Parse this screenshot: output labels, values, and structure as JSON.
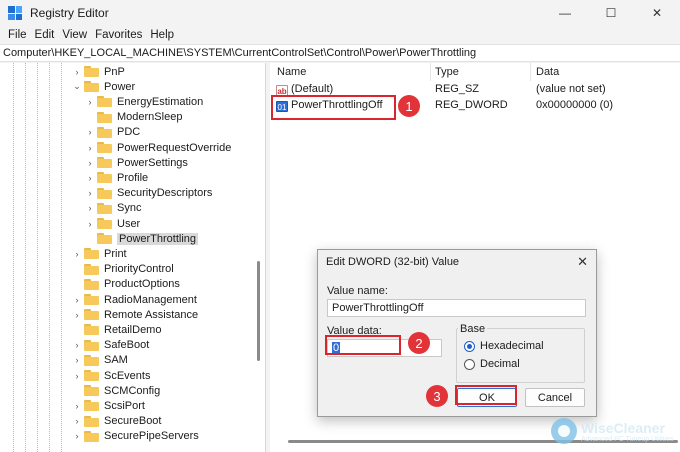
{
  "window": {
    "title": "Registry Editor",
    "minimize": "—",
    "maximize": "☐",
    "close": "✕"
  },
  "menu": [
    "File",
    "Edit",
    "View",
    "Favorites",
    "Help"
  ],
  "address": "Computer\\HKEY_LOCAL_MACHINE\\SYSTEM\\CurrentControlSet\\Control\\Power\\PowerThrottling",
  "tree": {
    "items": [
      {
        "label": "PnP",
        "level": 1,
        "chevron": "›"
      },
      {
        "label": "Power",
        "level": 1,
        "chevron": "⌄"
      },
      {
        "label": "EnergyEstimation",
        "level": 2,
        "chevron": "›"
      },
      {
        "label": "ModernSleep",
        "level": 2,
        "chevron": ""
      },
      {
        "label": "PDC",
        "level": 2,
        "chevron": "›"
      },
      {
        "label": "PowerRequestOverride",
        "level": 2,
        "chevron": "›"
      },
      {
        "label": "PowerSettings",
        "level": 2,
        "chevron": "›"
      },
      {
        "label": "Profile",
        "level": 2,
        "chevron": "›"
      },
      {
        "label": "SecurityDescriptors",
        "level": 2,
        "chevron": "›"
      },
      {
        "label": "Sync",
        "level": 2,
        "chevron": "›"
      },
      {
        "label": "User",
        "level": 2,
        "chevron": "›"
      },
      {
        "label": "PowerThrottling",
        "level": 2,
        "chevron": "",
        "selected": true
      },
      {
        "label": "Print",
        "level": 1,
        "chevron": "›"
      },
      {
        "label": "PriorityControl",
        "level": 1,
        "chevron": ""
      },
      {
        "label": "ProductOptions",
        "level": 1,
        "chevron": ""
      },
      {
        "label": "RadioManagement",
        "level": 1,
        "chevron": "›"
      },
      {
        "label": "Remote Assistance",
        "level": 1,
        "chevron": "›"
      },
      {
        "label": "RetailDemo",
        "level": 1,
        "chevron": ""
      },
      {
        "label": "SafeBoot",
        "level": 1,
        "chevron": "›"
      },
      {
        "label": "SAM",
        "level": 1,
        "chevron": "›"
      },
      {
        "label": "ScEvents",
        "level": 1,
        "chevron": "›"
      },
      {
        "label": "SCMConfig",
        "level": 1,
        "chevron": ""
      },
      {
        "label": "ScsiPort",
        "level": 1,
        "chevron": "›"
      },
      {
        "label": "SecureBoot",
        "level": 1,
        "chevron": "›"
      },
      {
        "label": "SecurePipeServers",
        "level": 1,
        "chevron": "›"
      }
    ]
  },
  "list": {
    "columns": [
      "Name",
      "Type",
      "Data"
    ],
    "rows": [
      {
        "icon": "ab",
        "name": "(Default)",
        "type": "REG_SZ",
        "data": "(value not set)"
      },
      {
        "icon": "dw",
        "name": "PowerThrottlingOff",
        "type": "REG_DWORD",
        "data": "0x00000000 (0)"
      }
    ]
  },
  "dialog": {
    "title": "Edit DWORD (32-bit) Value",
    "close": "✕",
    "value_name_label": "Value name:",
    "value_name": "PowerThrottlingOff",
    "value_data_label": "Value data:",
    "value_data": "0",
    "base_label": "Base",
    "hex_label": "Hexadecimal",
    "dec_label": "Decimal",
    "base_selected": "Hexadecimal",
    "ok_label": "OK",
    "cancel_label": "Cancel"
  },
  "steps": [
    "1",
    "2",
    "3"
  ],
  "watermark": {
    "main": "WiseCleaner",
    "sub": "Advanced PC Tuneup Utilities"
  },
  "colors": {
    "highlight": "#d8262c",
    "step_badge": "#e23338",
    "folder": "#f7c95a",
    "accent": "#1f5ec4"
  }
}
